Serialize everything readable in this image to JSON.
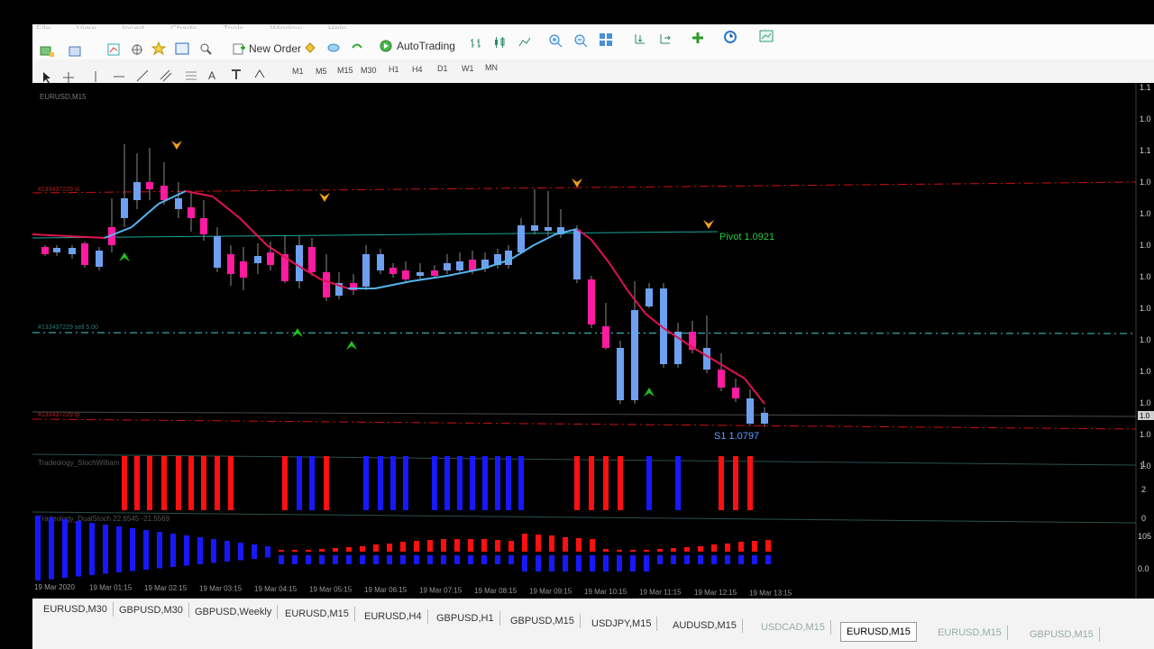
{
  "menu": [
    "File",
    "View",
    "Insert",
    "Charts",
    "Tools",
    "Window",
    "Help"
  ],
  "toolbar": {
    "new_order": "New Order",
    "auto_trading": "AutoTrading"
  },
  "timeframes": [
    "M1",
    "M5",
    "M15",
    "M30",
    "H1",
    "H4",
    "D1",
    "W1",
    "MN"
  ],
  "chart": {
    "symbol": "EURUSD,M15",
    "sl_line": "#133437229 sl",
    "sell_line": "#133437229 sell 5.00",
    "tp_line": "#133437229 tp",
    "pivot_label": "Pivot 1.0921",
    "s1_label": "S1 1.0797",
    "price_marker": "1.0"
  },
  "indicators": {
    "stoch_williams": "Tradeology_StochWilliam",
    "dual_stoch": "Tradeology_DualStoch 22.6545 -21.5569",
    "dual_stoch_ticks": [
      "105",
      "0.0"
    ]
  },
  "price_axis": [
    "1.1",
    "1.0",
    "1.1",
    "1.0",
    "1.0",
    "1.0",
    "1.0",
    "1.0",
    "1.0",
    "1.0",
    "1.0",
    "1.0",
    "1.0"
  ],
  "sub_axis": [
    "1",
    "2",
    "0"
  ],
  "time_axis": [
    "19 Mar 2020",
    "19 Mar 01:15",
    "19 Mar 02:15",
    "19 Mar 03:15",
    "19 Mar 04:15",
    "19 Mar 05:15",
    "19 Mar 06:15",
    "19 Mar 07:15",
    "19 Mar 08:15",
    "19 Mar 09:15",
    "19 Mar 10:15",
    "19 Mar 11:15",
    "19 Mar 12:15",
    "19 Mar 13:15"
  ],
  "tabs": [
    "EURUSD,M30",
    "GBPUSD,M30",
    "GBPUSD,Weekly",
    "EURUSD,M15",
    "EURUSD,H4",
    "GBPUSD,H1",
    "GBPUSD,M15",
    "USDJPY,M15",
    "AUDUSD,M15",
    "USDCAD,M15",
    "EURUSD,M15",
    "EURUSD,M15",
    "GBPUSD,M15"
  ],
  "colors": {
    "bull": "#6ea0f0",
    "bear": "#ff1aa0",
    "ma_up": "#56b4f0",
    "ma_down": "#e0134f",
    "sl": "#d01010",
    "pivot": "#18a89a",
    "sell": "#40d0d0",
    "histo_red": "#ff1010",
    "histo_blue": "#1818ff"
  }
}
